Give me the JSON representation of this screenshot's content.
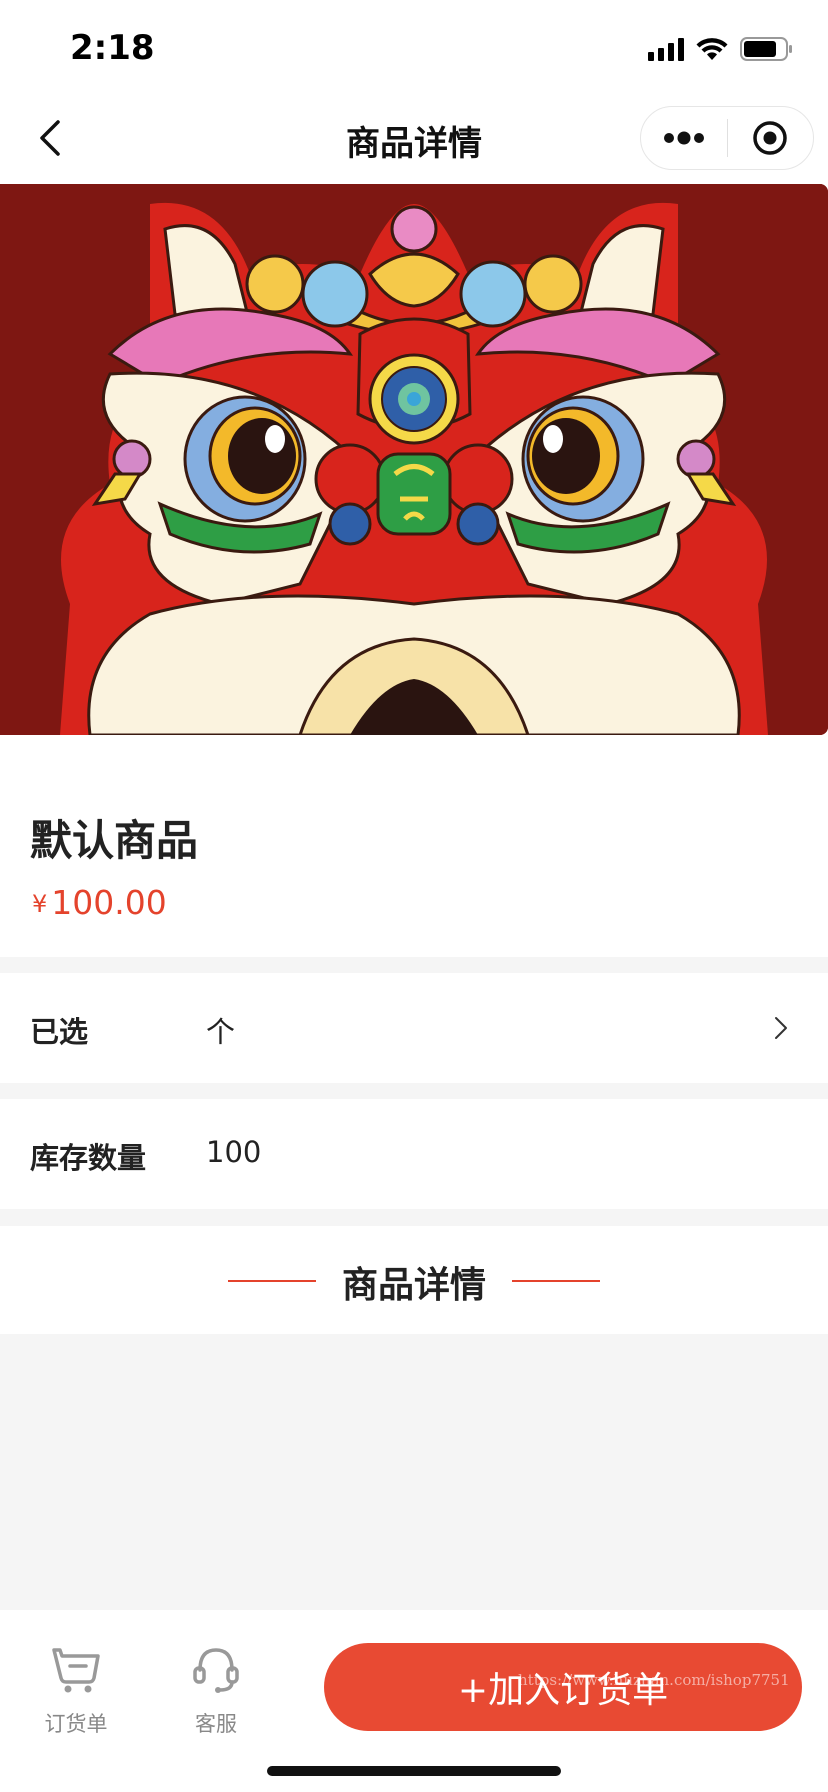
{
  "status_bar": {
    "time": "2:18",
    "icons": [
      "signal-icon",
      "wifi-icon",
      "battery-icon"
    ]
  },
  "nav": {
    "title": "商品详情",
    "back_icon": "chevron-left-icon",
    "more_icon": "more-dots-icon",
    "close_icon": "target-circle-icon"
  },
  "product": {
    "image": "lion-dance-head-illustration",
    "name": "默认商品",
    "currency": "¥",
    "price": "100.00"
  },
  "selected_row": {
    "label": "已选",
    "value": "个"
  },
  "stock_row": {
    "label": "库存数量",
    "value": "100"
  },
  "details_section": {
    "title": "商品详情"
  },
  "bottom_bar": {
    "order_label": "订货单",
    "service_label": "客服",
    "add_button": "+加入订货单",
    "watermark": "https://www.huzhan.com/ishop7751"
  },
  "colors": {
    "accent": "#e84a33",
    "price": "#e4432c",
    "background_gray": "#f5f5f5",
    "hero_background": "#7e1712"
  }
}
